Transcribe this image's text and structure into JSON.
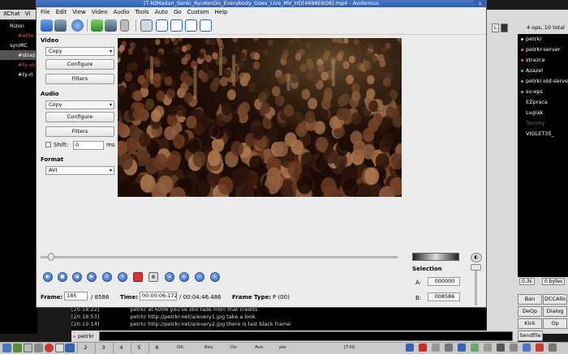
{
  "xchat": {
    "menu": [
      "XChat",
      "Vi"
    ],
    "network": "Rizon",
    "channels": [
      "#elite",
      "synIRC",
      "#straz",
      "#ty-vid",
      "#ty-ri"
    ],
    "ops_label": "4 ops, 10 total",
    "topic_button": "L",
    "users": [
      {
        "name": "petrkr",
        "color": "#dddddd"
      },
      {
        "name": "petrkr-server",
        "color": "#e05fd0"
      },
      {
        "name": "strazce",
        "color": "#e05fd0"
      },
      {
        "name": "Azazel",
        "color": "#4ad24a"
      },
      {
        "name": "petrkr-old-serve",
        "color": "#4ad24a"
      },
      {
        "name": "sv-eps",
        "color": "#4ad24a"
      },
      {
        "name": "EZpraca",
        "color": ""
      },
      {
        "name": "Lugiak",
        "color": ""
      },
      {
        "name": "Tommy",
        "color": ""
      },
      {
        "name": "VIOLET35_",
        "color": ""
      }
    ],
    "lag": "0.3s",
    "bytes": "0 bytes",
    "buttons": [
      "Ban",
      "DCCAllo",
      "DeOp",
      "Dialog",
      "Kick",
      "Op",
      "Sendfile"
    ],
    "chat": [
      {
        "time": "[20:18:22]",
        "nick": "petrkr",
        "text": "at 6006 you've still fade from that credits"
      },
      {
        "time": "[20:18:53]",
        "nick": "petrkr",
        "text": "http://petrkr.net/a/every1.jpg take a look"
      },
      {
        "time": "[20:19:14]",
        "nick": "petrkr",
        "text": "http://petrkr.net/a/every2.jpg there is last black frame"
      }
    ],
    "input_nick": "petrkr"
  },
  "taskbar": {
    "workspaces": [
      "2",
      "3",
      "4",
      "5",
      "6"
    ],
    "tasks": [
      "Ob",
      "Bav",
      "Do",
      "Ave",
      "per",
      "[T-N]"
    ]
  },
  "avidemux": {
    "title": "[T-N]Madan_Senki_RyuKenDo_Everybody_Goes_Live_MV_HD[4698E6D8].mp4 - Avidemux",
    "menu": [
      "File",
      "Edit",
      "View",
      "Video",
      "Audio",
      "Tools",
      "Auto",
      "Go",
      "Custom",
      "Help"
    ],
    "video_section": "Video",
    "video_codec": "Copy",
    "configure_label": "Configure",
    "filters_label": "Filters",
    "audio_section": "Audio",
    "audio_codec": "Copy",
    "shift_label": "Shift:",
    "shift_value": "0",
    "shift_unit": "ms",
    "format_section": "Format",
    "format_value": "AVI",
    "selection_label": "Selection",
    "sel_a_label": "A:",
    "sel_a": "000000",
    "sel_b_label": "B:",
    "sel_b": "008586",
    "frame_label": "Frame:",
    "frame_value": "185",
    "frame_total": "/ 8586",
    "time_label": "Time:",
    "time_value": "00:00:06.172",
    "time_total": "/ 00:04:46.486",
    "frame_type_label": "Frame Type:",
    "frame_type": "P (00)",
    "seek_position": 0.02
  }
}
